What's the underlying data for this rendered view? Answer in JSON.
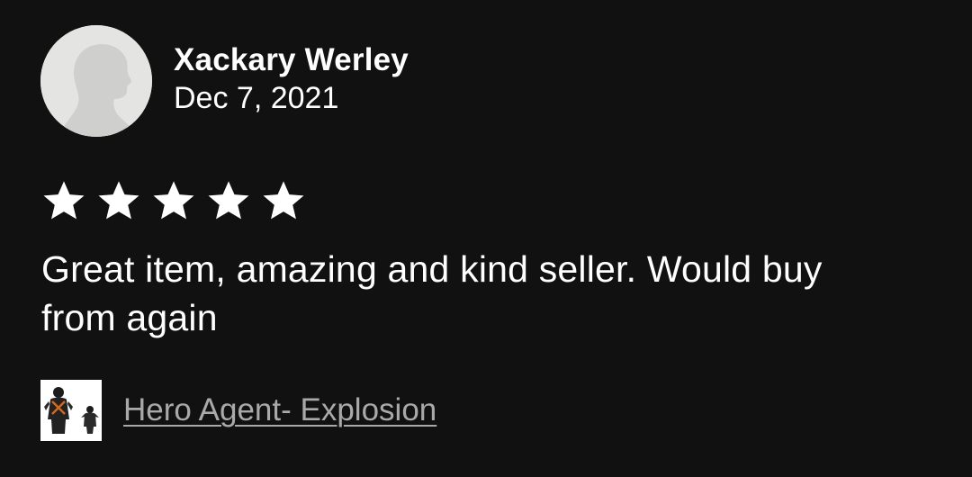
{
  "review": {
    "reviewer_name": "Xackary Werley",
    "date": "Dec 7, 2021",
    "rating": 5,
    "rating_max": 5,
    "text": "Great item, amazing and kind seller. Would buy from again",
    "item": {
      "title": "Hero Agent- Explosion",
      "thumbnail_icon": "hero-agent-figure-icon"
    }
  },
  "colors": {
    "background": "#111111",
    "text": "#ffffff",
    "link": "#a9a9a9",
    "avatar_bg": "#e4e4e2",
    "star": "#ffffff"
  }
}
